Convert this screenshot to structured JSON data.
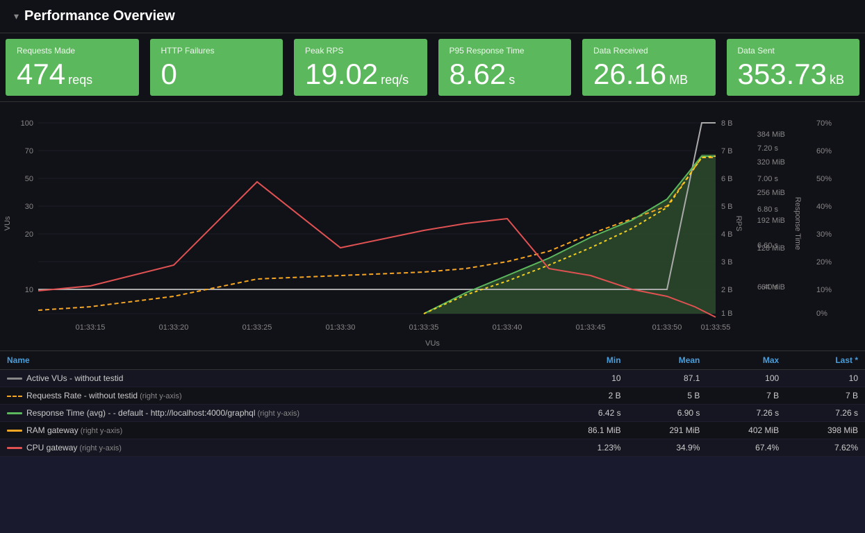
{
  "header": {
    "chevron": "▾",
    "title": "Performance Overview"
  },
  "metrics": [
    {
      "id": "requests-made",
      "label": "Requests Made",
      "value": "474",
      "unit": "reqs"
    },
    {
      "id": "http-failures",
      "label": "HTTP Failures",
      "value": "0",
      "unit": ""
    },
    {
      "id": "peak-rps",
      "label": "Peak RPS",
      "value": "19.02",
      "unit": "req/s"
    },
    {
      "id": "p95-response",
      "label": "P95 Response Time",
      "value": "8.62",
      "unit": "s"
    },
    {
      "id": "data-received",
      "label": "Data Received",
      "value": "26.16",
      "unit": "MB"
    },
    {
      "id": "data-sent",
      "label": "Data Sent",
      "value": "353.73",
      "unit": "kB"
    }
  ],
  "chart": {
    "x_axis_label": "VUs",
    "y_left_label": "VUs",
    "y_right_label1": "RPS",
    "y_right_label2": "Response Time",
    "x_ticks": [
      "01:33:15",
      "01:33:20",
      "01:33:25",
      "01:33:30",
      "01:33:35",
      "01:33:40",
      "01:33:45",
      "01:33:50",
      "01:33:55"
    ],
    "y_left_ticks": [
      "100",
      "70",
      "50",
      "30",
      "20",
      "10"
    ],
    "y_right_ticks_rps": [
      "8 B",
      "7 B",
      "6 B",
      "5 B",
      "4 B",
      "3 B",
      "2 B",
      "1 B"
    ],
    "y_right_ticks_rt": [
      "7.20 s",
      "7.00 s",
      "6.80 s",
      "6.60 s",
      "6.40 s"
    ],
    "y_far_right_ticks": [
      "70%",
      "60%",
      "50%",
      "40%",
      "30%",
      "20%",
      "10%",
      "0%"
    ],
    "y_far_right_data": [
      "384 MiB",
      "320 MiB",
      "256 MiB",
      "192 MiB",
      "128 MiB",
      "64 MiB"
    ]
  },
  "table": {
    "headers": [
      "Name",
      "Min",
      "Mean",
      "Max",
      "Last *"
    ],
    "rows": [
      {
        "series_color": "#888888",
        "series_style": "solid",
        "name": "Active VUs - without testid",
        "note": "",
        "min": "10",
        "mean": "87.1",
        "max": "100",
        "last": "10"
      },
      {
        "series_color": "#f5a623",
        "series_style": "dashed",
        "name": "Requests Rate - without testid",
        "note": "(right y-axis)",
        "min": "2 B",
        "mean": "5 B",
        "max": "7 B",
        "last": "7 B"
      },
      {
        "series_color": "#5cb85c",
        "series_style": "solid",
        "name": "Response Time (avg) - - default - http://localhost:4000/graphql",
        "note": "(right y-axis)",
        "min": "6.42 s",
        "mean": "6.90 s",
        "max": "7.26 s",
        "last": "7.26 s"
      },
      {
        "series_color": "#f5a623",
        "series_style": "solid",
        "name": "RAM gateway",
        "note": "(right y-axis)",
        "min": "86.1 MiB",
        "mean": "291 MiB",
        "max": "402 MiB",
        "last": "398 MiB"
      },
      {
        "series_color": "#e05252",
        "series_style": "solid",
        "name": "CPU gateway",
        "note": "(right y-axis)",
        "min": "1.23%",
        "mean": "34.9%",
        "max": "67.4%",
        "last": "7.62%"
      }
    ]
  }
}
